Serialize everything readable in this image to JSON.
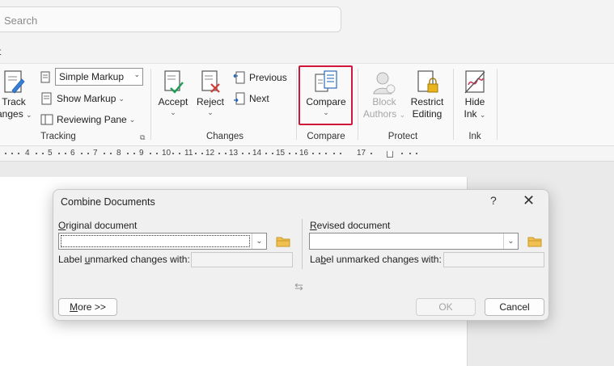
{
  "search": {
    "placeholder": "Search"
  },
  "tabs": {
    "fragment": "t"
  },
  "tracking": {
    "track_changes_line1": "Track",
    "track_changes_line2": "anges",
    "markup_value": "Simple Markup",
    "show_markup": "Show Markup",
    "reviewing_pane": "Reviewing Pane",
    "group_label": "Tracking"
  },
  "changes": {
    "accept": "Accept",
    "reject": "Reject",
    "previous": "Previous",
    "next": "Next",
    "group_label": "Changes"
  },
  "compare": {
    "button": "Compare",
    "group_label": "Compare"
  },
  "protect": {
    "block_line1": "Block",
    "block_line2": "Authors",
    "restrict_line1": "Restrict",
    "restrict_line2": "Editing",
    "group_label": "Protect"
  },
  "ink": {
    "hide_line1": "Hide",
    "hide_line2": "Ink",
    "group_label": "Ink"
  },
  "ruler": {
    "numbers": [
      "4",
      "5",
      "6",
      "7",
      "8",
      "9",
      "10",
      "11",
      "12",
      "13",
      "14",
      "15",
      "16",
      "17"
    ]
  },
  "dialog": {
    "title": "Combine Documents",
    "help": "?",
    "close": "✕",
    "original_label_pre": "",
    "original_label_key": "O",
    "original_label_post": "riginal document",
    "original_value": "",
    "revised_label_key": "R",
    "revised_label_post": "evised document",
    "revised_value": "",
    "label_unmarked_left_pre": "Label ",
    "label_unmarked_left_key": "u",
    "label_unmarked_left_post": "nmarked changes with:",
    "label_unmarked_right_pre": "La",
    "label_unmarked_right_key": "b",
    "label_unmarked_right_post": "el unmarked changes with:",
    "more_key": "M",
    "more_post": "ore >>",
    "ok": "OK",
    "cancel": "Cancel"
  },
  "colors": {
    "highlight": "#d0173b",
    "accent": "#1a5fb4"
  }
}
